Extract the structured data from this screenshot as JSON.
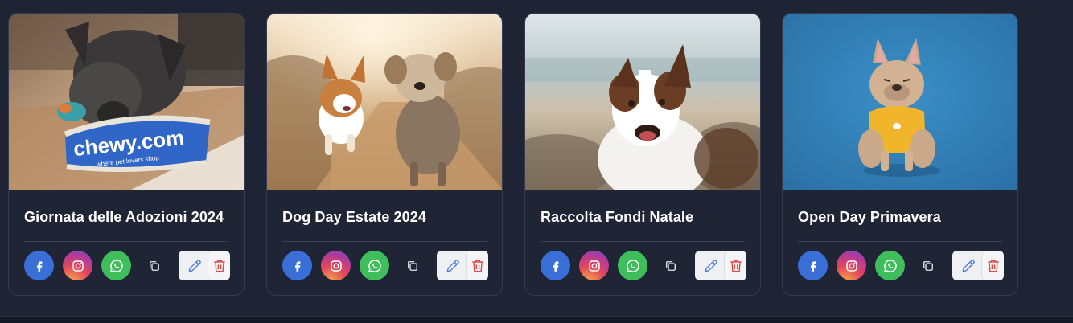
{
  "cards": [
    {
      "title": "Giornata delle Adozioni 2024",
      "photo": "dog-with-chewy-toy-photo"
    },
    {
      "title": "Dog Day Estate 2024",
      "photo": "corgi-and-terrier-running-photo"
    },
    {
      "title": "Raccolta Fondi Natale",
      "photo": "border-collie-beach-photo"
    },
    {
      "title": "Open Day Primavera",
      "photo": "french-bulldog-yellow-sweater-photo"
    }
  ],
  "photo_texts": {
    "chewy_logo": "chewy.com",
    "chewy_tagline": "where pet lovers shop"
  },
  "icons": {
    "facebook": "facebook-icon",
    "instagram": "instagram-icon",
    "whatsapp": "whatsapp-icon",
    "copy": "copy-icon",
    "edit": "pencil-icon",
    "delete": "trash-icon"
  },
  "colors": {
    "background": "#1e2433",
    "card": "#1f2535",
    "facebook": "#3b6fd8",
    "whatsapp": "#3fbf5b",
    "edit_icon": "#4a78d6",
    "delete_icon": "#e04848"
  }
}
